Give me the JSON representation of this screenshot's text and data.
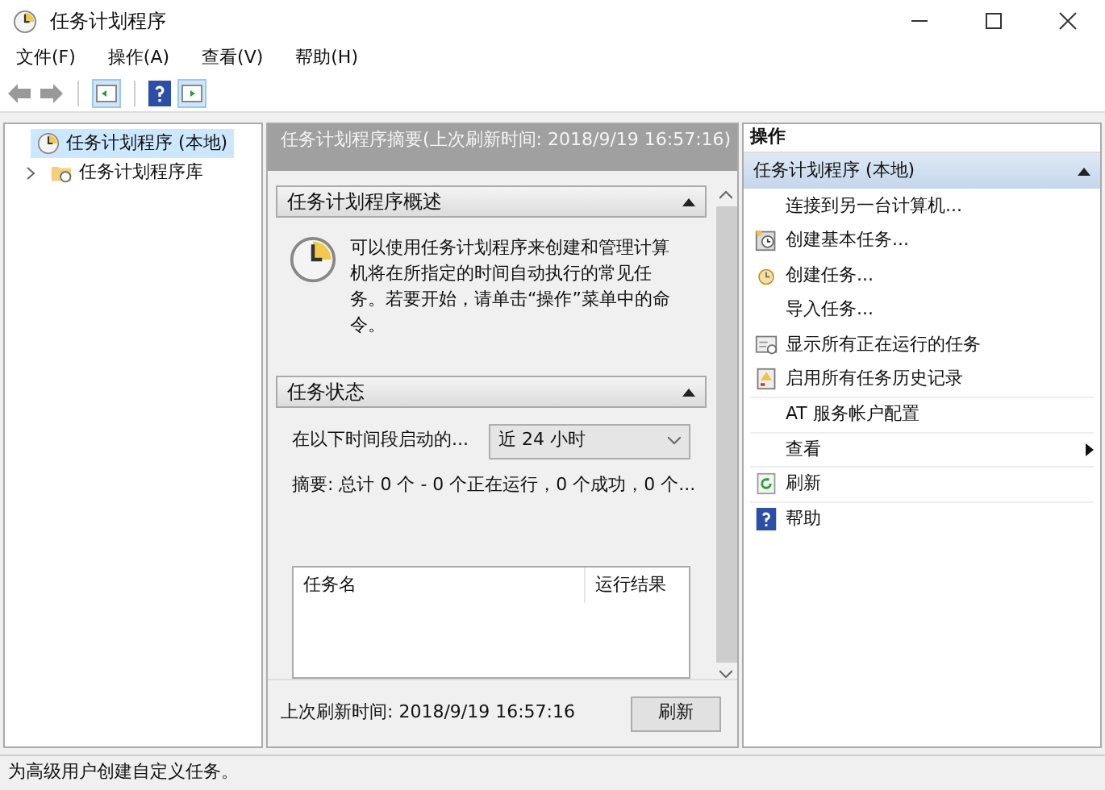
{
  "window": {
    "title": "任务计划程序"
  },
  "menu": [
    "文件(F)",
    "操作(A)",
    "查看(V)",
    "帮助(H)"
  ],
  "tree": [
    {
      "label": "任务计划程序 (本地)",
      "selected": true,
      "children": [
        {
          "label": "任务计划程序库",
          "selected": false,
          "expanded": false
        }
      ]
    }
  ],
  "summary": {
    "header": "任务计划程序摘要(上次刷新时间: 2018/9/19 16:57:16)",
    "overview": {
      "title": "任务计划程序概述",
      "expanded": true,
      "text": "可以使用任务计划程序来创建和管理计算机将在所指定的时间自动执行的常见任务。若要开始，请单击“操作”菜单中的命令。"
    },
    "status": {
      "title": "任务状态",
      "expanded": true,
      "period_label": "在以下时间段启动的...",
      "period_value": "近 24 小时",
      "summary": "摘要: 总计 0 个 - 0 个正在运行，0 个成功，0 个...",
      "columns": [
        "任务名",
        "运行结果"
      ]
    },
    "last_refresh": "上次刷新时间: 2018/9/19 16:57:16",
    "refresh_button": "刷新"
  },
  "actions": {
    "title": "操作",
    "group": "任务计划程序 (本地)",
    "expanded": true,
    "items": [
      {
        "kind": "plain",
        "label": "连接到另一台计算机..."
      },
      {
        "kind": "basic-task",
        "label": "创建基本任务..."
      },
      {
        "kind": "task",
        "label": "创建任务..."
      },
      {
        "kind": "plain",
        "label": "导入任务..."
      },
      {
        "kind": "running",
        "label": "显示所有正在运行的任务"
      },
      {
        "kind": "history",
        "label": "启用所有任务历史记录"
      },
      {
        "kind": "plain",
        "label": "AT 服务帐户配置"
      },
      {
        "kind": "submenu",
        "label": "查看"
      },
      {
        "kind": "refresh",
        "label": "刷新"
      },
      {
        "kind": "help",
        "label": "帮助"
      }
    ]
  },
  "status_bar": "为高级用户创建自定义任务。"
}
